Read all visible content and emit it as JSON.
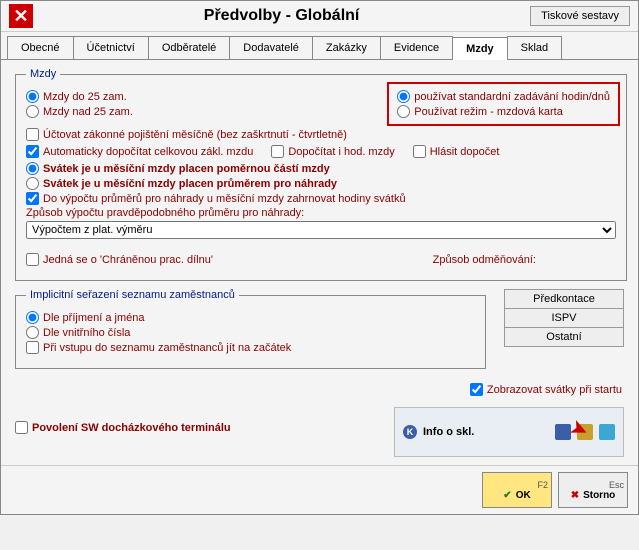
{
  "window": {
    "title": "Předvolby - Globální",
    "print_button": "Tiskové sestavy"
  },
  "tabs": {
    "obecne": "Obecné",
    "ucetnictvi": "Účetnictví",
    "odberatele": "Odběratelé",
    "dodavatele": "Dodavatelé",
    "zakazky": "Zakázky",
    "evidence": "Evidence",
    "mzdy": "Mzdy",
    "sklad": "Sklad"
  },
  "mzdy": {
    "legend": "Mzdy",
    "do25": "Mzdy do 25 zam.",
    "nad25": "Mzdy nad 25 zam.",
    "use_std": "používat standardní zadávání hodin/dnů",
    "use_card": "Používat režim - mzdová karta",
    "uctovat": "Účtovat zákonné pojištění měsíčně (bez zaškrtnutí - čtvrtletně)",
    "auto_dopocitat": "Automaticky dopočítat celkovou zákl. mzdu",
    "dopocitat_hod": "Dopočítat i hod. mzdy",
    "hlasit": "Hlásit dopočet",
    "svatek_pomer": "Svátek je u měsíční mzdy placen poměrnou částí mzdy",
    "svatek_prumer": "Svátek je u měsíční mzdy placen průměrem pro náhrady",
    "do_vypoctu": "Do výpočtu průměrů pro náhrady u měsíční mzdy zahrnovat hodiny svátků",
    "zpusob_label": "Způsob výpočtu pravděpodobného průměru pro náhrady:",
    "select_val": "Výpočtem z plat. výměru",
    "chranena": "Jedná se o 'Chráněnou prac. dílnu'",
    "zpusob_odmen": "Způsob odměňování:"
  },
  "sort": {
    "legend": "Implicitní seřazení seznamu zaměstnanců",
    "prijmeni": "Dle příjmení a jména",
    "cisla": "Dle vnitřního čísla",
    "zacatek": "Při vstupu do seznamu zaměstnanců jít na začátek"
  },
  "buttons": {
    "predkontace": "Předkontace",
    "ispv": "ISPV",
    "ostatni": "Ostatní"
  },
  "zobrazovat": "Zobrazovat svátky při startu",
  "povoleni": "Povolení SW docházkového terminálu",
  "tray": {
    "info": "Info o skl."
  },
  "bottom": {
    "ok": "OK",
    "ok_key": "F2",
    "storno": "Storno",
    "storno_key": "Esc"
  }
}
